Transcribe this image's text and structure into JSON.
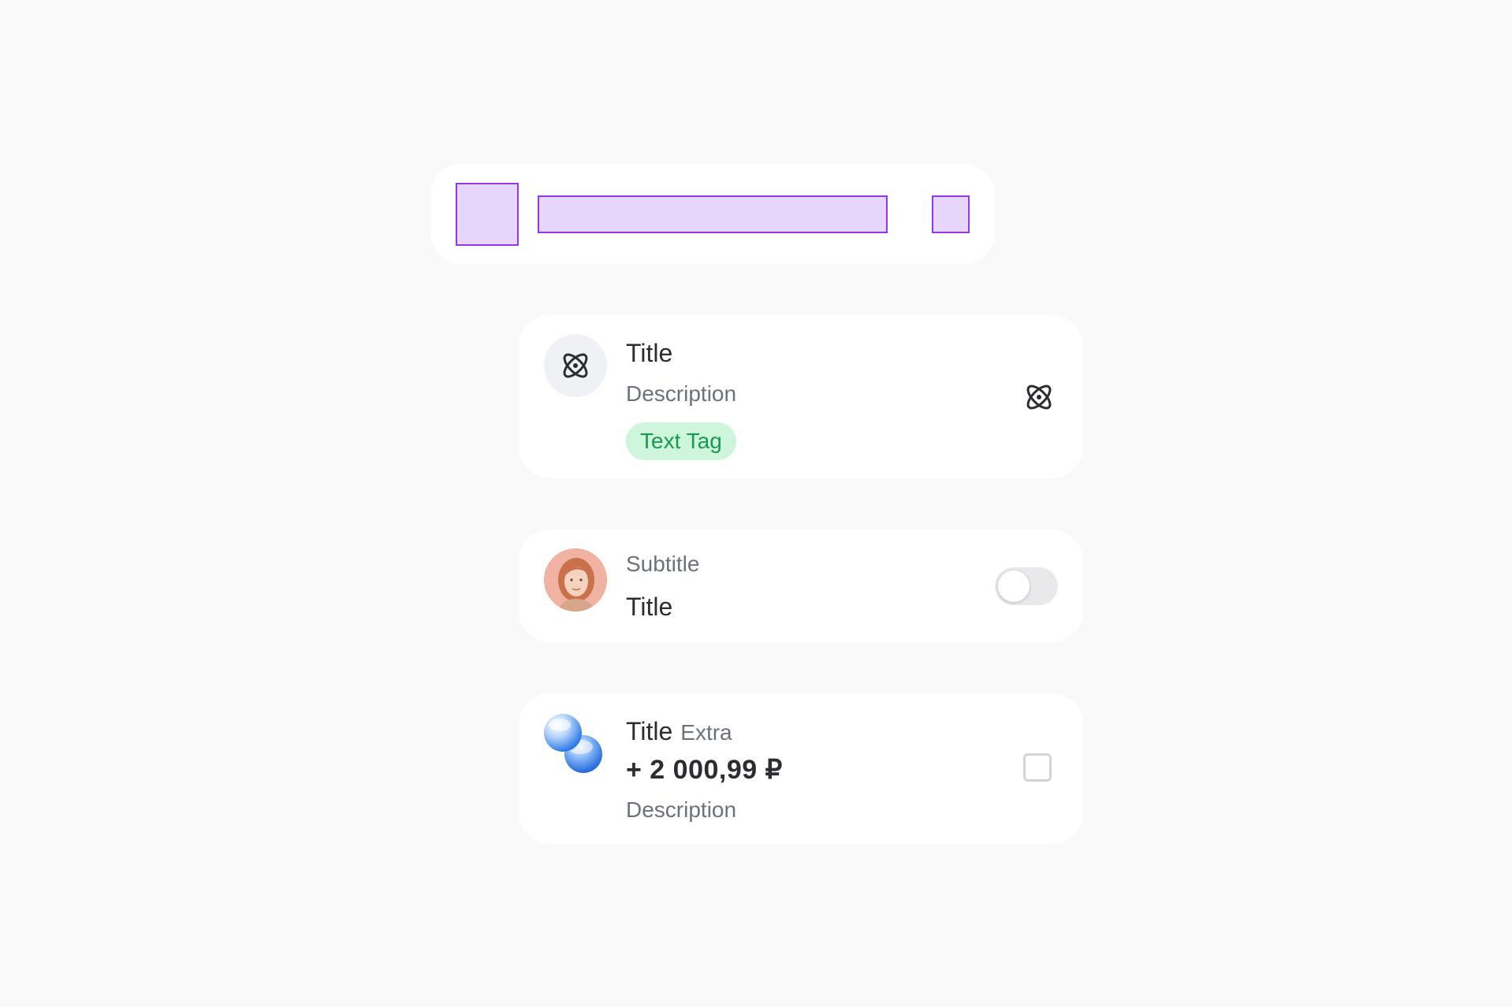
{
  "cell_1": {
    "title": "Title",
    "description": "Description",
    "tag": "Text Tag",
    "leading_icon": "atom-icon",
    "trailing_icon": "atom-icon"
  },
  "cell_2": {
    "subtitle": "Subtitle",
    "title": "Title",
    "toggle_on": false
  },
  "cell_3": {
    "title": "Title",
    "extra": "Extra",
    "amount": "+ 2 000,99 ₽",
    "description": "Description",
    "checkbox_checked": false
  },
  "colors": {
    "background": "#f9f9f9",
    "card": "#ffffff",
    "slot_fill": "#e6d6fb",
    "slot_border": "#9338e6",
    "tag_bg": "#cdf6dc",
    "tag_text": "#1a9a4f",
    "text_primary": "#2b2d33",
    "text_secondary": "#6b7180"
  }
}
